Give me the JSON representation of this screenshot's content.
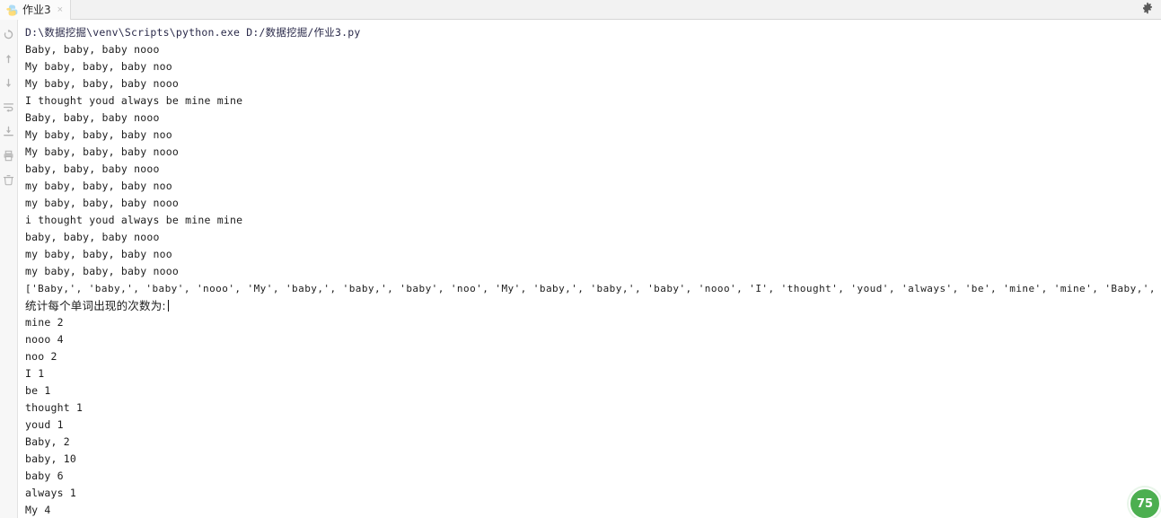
{
  "window": {
    "tab": {
      "label": "作业3",
      "icon": "python-file-icon",
      "close_label": "×"
    },
    "settings_icon": "gear-icon"
  },
  "left_toolbar": {
    "items": [
      {
        "name": "rerun-icon",
        "glyph": "↺"
      },
      {
        "name": "scroll-up-icon",
        "glyph": "↑"
      },
      {
        "name": "scroll-down-icon",
        "glyph": "↓"
      },
      {
        "name": "soft-wrap-icon",
        "glyph": "↵"
      },
      {
        "name": "export-icon",
        "glyph": "⤓"
      },
      {
        "name": "print-icon",
        "glyph": "⎙"
      },
      {
        "name": "clear-all-icon",
        "glyph": "🗑"
      }
    ]
  },
  "console": {
    "lines": [
      {
        "text": "D:\\数据挖掘\\venv\\Scripts\\python.exe D:/数据挖掘/作业3.py",
        "style": "cmd"
      },
      {
        "text": "Baby, baby, baby nooo",
        "style": "out"
      },
      {
        "text": "My baby, baby, baby noo",
        "style": "out"
      },
      {
        "text": "My baby, baby, baby nooo",
        "style": "out"
      },
      {
        "text": "I thought youd always be mine mine",
        "style": "out"
      },
      {
        "text": "Baby, baby, baby nooo",
        "style": "out"
      },
      {
        "text": "My baby, baby, baby noo",
        "style": "out"
      },
      {
        "text": "My baby, baby, baby nooo",
        "style": "out"
      },
      {
        "text": "baby, baby, baby nooo",
        "style": "out"
      },
      {
        "text": "my baby, baby, baby noo",
        "style": "out"
      },
      {
        "text": "my baby, baby, baby nooo",
        "style": "out"
      },
      {
        "text": "i thought youd always be mine mine",
        "style": "out"
      },
      {
        "text": "baby, baby, baby nooo",
        "style": "out"
      },
      {
        "text": "my baby, baby, baby noo",
        "style": "out"
      },
      {
        "text": "my baby, baby, baby nooo",
        "style": "out"
      },
      {
        "text": "['Baby,', 'baby,', 'baby', 'nooo', 'My', 'baby,', 'baby,', 'baby', 'noo', 'My', 'baby,', 'baby,', 'baby', 'nooo', 'I', 'thought', 'youd', 'always', 'be', 'mine', 'mine', 'Baby,', 'baby,', 'baby', 'nooo', 'My', '",
        "style": "wide"
      },
      {
        "text": "统计每个单词出现的次数为:",
        "style": "cjk",
        "caret": true
      },
      {
        "text": "mine 2",
        "style": "out"
      },
      {
        "text": "nooo 4",
        "style": "out"
      },
      {
        "text": "noo 2",
        "style": "out"
      },
      {
        "text": "I 1",
        "style": "out"
      },
      {
        "text": "be 1",
        "style": "out"
      },
      {
        "text": "thought 1",
        "style": "out"
      },
      {
        "text": "youd 1",
        "style": "out"
      },
      {
        "text": "Baby, 2",
        "style": "out"
      },
      {
        "text": "baby, 10",
        "style": "out"
      },
      {
        "text": "baby 6",
        "style": "out"
      },
      {
        "text": "always 1",
        "style": "out"
      },
      {
        "text": "My 4",
        "style": "out"
      }
    ]
  },
  "status_badge": {
    "value": "75",
    "color": "#4caf50"
  }
}
